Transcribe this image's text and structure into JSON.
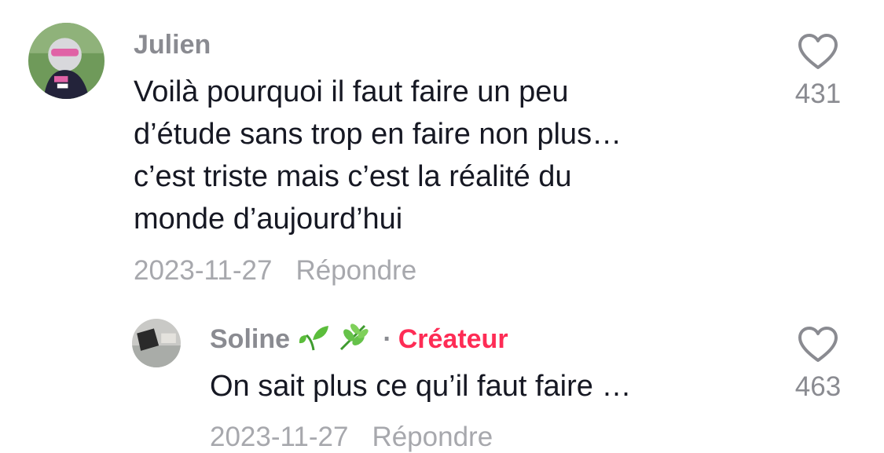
{
  "comments": [
    {
      "author": "Julien",
      "text": "Voilà pourquoi il faut faire un peu\nd’étude sans trop en faire non plus…\nc’est triste mais c’est la réalité du\nmonde d’aujourd’hui",
      "date": "2023-11-27",
      "reply_label": "Répondre",
      "likes": "431"
    },
    {
      "author": "Soline",
      "emojis": [
        "seedling-emoji",
        "herb-emoji"
      ],
      "separator": "·",
      "badge": "Créateur",
      "text": "On sait plus ce qu’il faut faire …",
      "date": "2023-11-27",
      "reply_label": "Répondre",
      "likes": "463"
    }
  ],
  "colors": {
    "author": "#8a8b91",
    "text": "#161823",
    "meta": "#a7a8ad",
    "creator_badge": "#fe2c55"
  },
  "icons": {
    "like": "heart-outline-icon"
  }
}
